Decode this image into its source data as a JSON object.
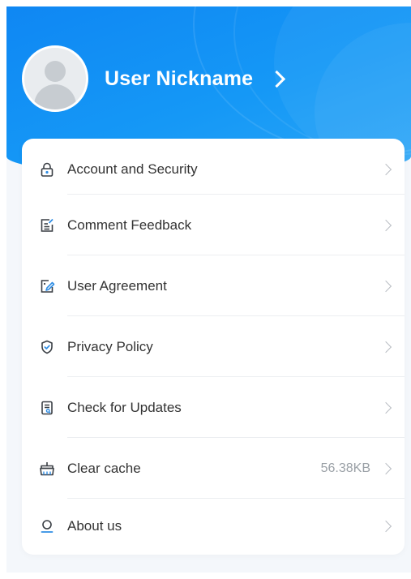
{
  "profile": {
    "nickname": "User Nickname"
  },
  "colors": {
    "header_blue": "#1592f5",
    "icon_dark": "#3a3f45",
    "icon_accent": "#2f8de4",
    "chevron": "#b8bcc2",
    "value_gray": "#9aa0a6"
  },
  "menu": {
    "items": [
      {
        "label": "Account and Security",
        "icon": "lock-icon",
        "value": ""
      },
      {
        "label": "Comment Feedback",
        "icon": "feedback-icon",
        "value": ""
      },
      {
        "label": "User Agreement",
        "icon": "agreement-icon",
        "value": ""
      },
      {
        "label": "Privacy Policy",
        "icon": "shield-icon",
        "value": ""
      },
      {
        "label": "Check for Updates",
        "icon": "update-doc-icon",
        "value": ""
      },
      {
        "label": "Clear cache",
        "icon": "broom-icon",
        "value": "56.38KB"
      },
      {
        "label": "About us",
        "icon": "person-icon",
        "value": ""
      }
    ]
  }
}
